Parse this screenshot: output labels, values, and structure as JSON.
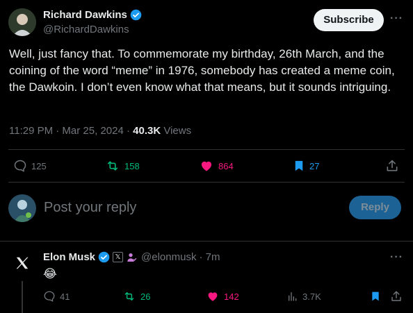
{
  "main_tweet": {
    "author_name": "Richard Dawkins",
    "author_handle": "@RichardDawkins",
    "subscribe_label": "Subscribe",
    "more_label": "···",
    "text": "Well, just fancy that. To commemorate my birthday, 26th March, and the coining of the word “meme” in 1976, somebody has created a meme coin, the Dawkoin. I don’t even know what that means, but it sounds intriguing.",
    "time": "11:29 PM · Mar 25, 2024 · ",
    "views_count": "40.3K",
    "views_label": " Views",
    "replies": "125",
    "retweets": "158",
    "likes": "864",
    "bookmarks": "27"
  },
  "reply_composer": {
    "placeholder": "Post your reply",
    "button_label": "Reply"
  },
  "reply_tweet": {
    "author_name": "Elon Musk",
    "author_handle": "@elonmusk",
    "time": "· 7m",
    "more_label": "···",
    "text": "😂",
    "replies": "41",
    "retweets": "26",
    "likes": "142",
    "views": "3.7K",
    "badge_letter": "𝕏"
  },
  "colors": {
    "verified": "#1d9bf0",
    "retweet": "#00ba7c",
    "like": "#f91880",
    "bookmark": "#1d9bf0",
    "reply_button": "#1d6294"
  }
}
